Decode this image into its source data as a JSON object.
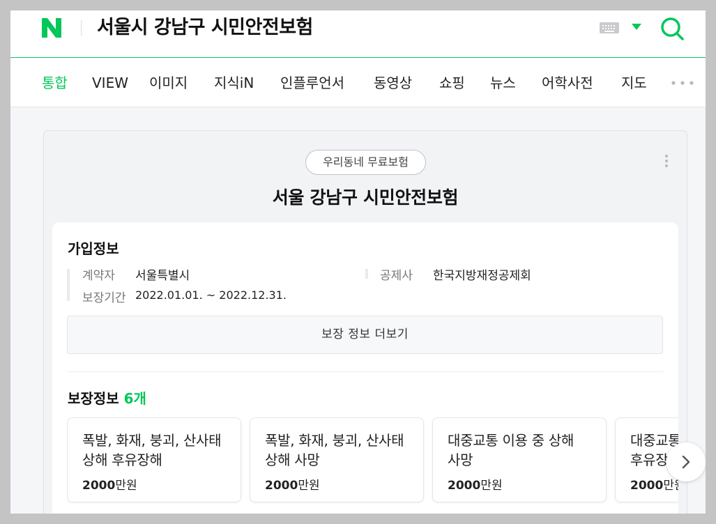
{
  "header": {
    "logo_text": "N",
    "query": "서울시 강남구 시민안전보험",
    "brand_color": "#03c75a",
    "icons": [
      "keyboard-icon",
      "dropdown-icon",
      "search-icon"
    ]
  },
  "tabs": [
    {
      "label": "통합",
      "active": true
    },
    {
      "label": "VIEW",
      "active": false
    },
    {
      "label": "이미지",
      "active": false
    },
    {
      "label": "지식iN",
      "active": false
    },
    {
      "label": "인플루언서",
      "active": false
    },
    {
      "label": "동영상",
      "active": false
    },
    {
      "label": "쇼핑",
      "active": false
    },
    {
      "label": "뉴스",
      "active": false
    },
    {
      "label": "어학사전",
      "active": false
    },
    {
      "label": "지도",
      "active": false
    }
  ],
  "card": {
    "pill": "우리동네 무료보험",
    "title": "서울 강남구 시민안전보험",
    "enroll": {
      "title": "가입정보",
      "contractor_label": "계약자",
      "contractor_value": "서울특별시",
      "insurer_label": "공제사",
      "insurer_value": "한국지방재정공제회",
      "period_label": "보장기간",
      "period_value": "2022.01.01. ~ 2022.12.31."
    },
    "more_button": "보장 정보 더보기",
    "coverage": {
      "title": "보장정보",
      "count": "6개",
      "items": [
        {
          "name": "폭발, 화재, 붕괴, 산사태 상해 후유장해",
          "amount_number": "2000",
          "amount_unit": "만원"
        },
        {
          "name": "폭발, 화재, 붕괴, 산사태 상해 사망",
          "amount_number": "2000",
          "amount_unit": "만원"
        },
        {
          "name": "대중교통 이용 중 상해 사망",
          "amount_number": "2000",
          "amount_unit": "만원"
        },
        {
          "name": "대중교통 이용 중 상해 후유장해",
          "amount_number": "2000",
          "amount_unit": "만원"
        }
      ]
    }
  }
}
